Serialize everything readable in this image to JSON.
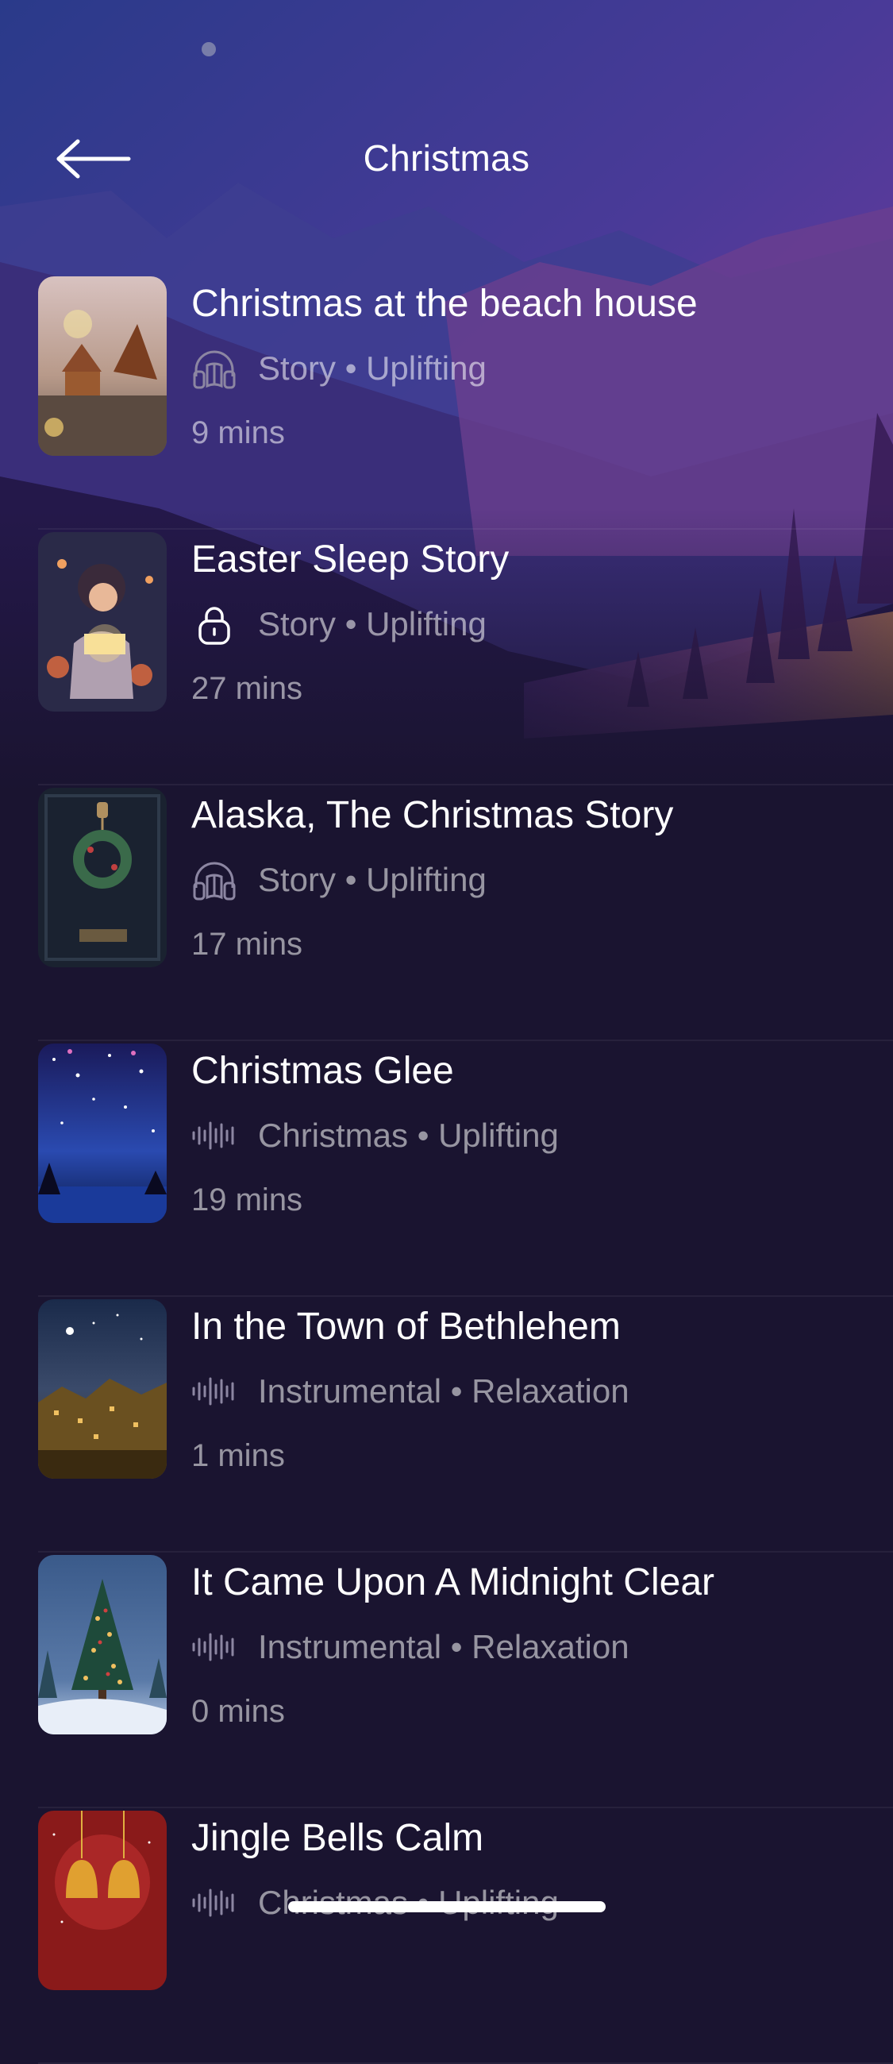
{
  "header": {
    "title": "Christmas"
  },
  "colors": {
    "background": "#1a1430",
    "accent": "#7a4cc2",
    "muted_text": "#9a93ad"
  },
  "items": [
    {
      "title": "Christmas at the beach house",
      "icon": "headphones-icon",
      "category": "Story • Uplifting",
      "duration": "9 mins"
    },
    {
      "title": "Easter Sleep Story",
      "icon": "lock-icon",
      "category": "Story • Uplifting",
      "duration": "27 mins"
    },
    {
      "title": "Alaska, The Christmas Story",
      "icon": "headphones-icon",
      "category": "Story • Uplifting",
      "duration": "17 mins"
    },
    {
      "title": "Christmas Glee",
      "icon": "waveform-icon",
      "category": "Christmas • Uplifting",
      "duration": "19 mins"
    },
    {
      "title": "In the Town of Bethlehem",
      "icon": "waveform-icon",
      "category": "Instrumental • Relaxation",
      "duration": "1 mins"
    },
    {
      "title": "It Came Upon A Midnight Clear",
      "icon": "waveform-icon",
      "category": "Instrumental • Relaxation",
      "duration": "0 mins"
    },
    {
      "title": "Jingle Bells Calm",
      "icon": "waveform-icon",
      "category": "Christmas • Uplifting",
      "duration": ""
    }
  ]
}
